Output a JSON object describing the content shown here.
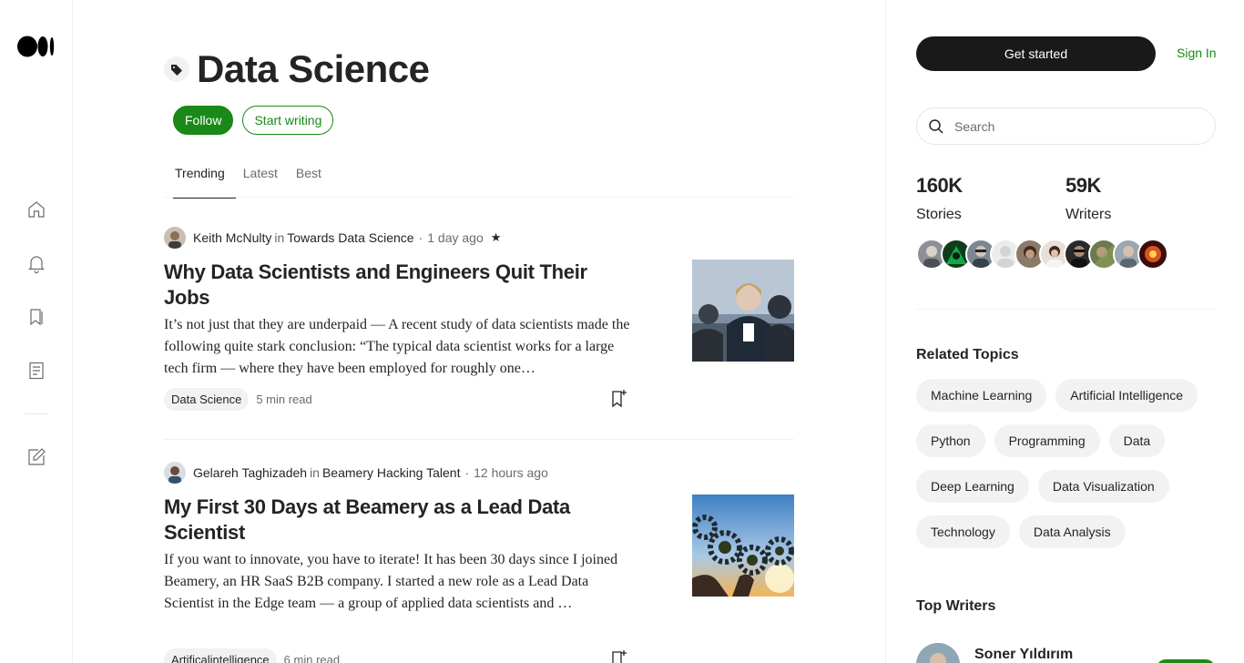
{
  "nav": {
    "logo": "medium-logo"
  },
  "topic": {
    "title": "Data Science",
    "follow_label": "Follow",
    "start_writing_label": "Start writing"
  },
  "tabs": [
    {
      "label": "Trending"
    },
    {
      "label": "Latest"
    },
    {
      "label": "Best"
    }
  ],
  "articles": [
    {
      "author": "Keith McNulty",
      "in": "in",
      "publication": "Towards Data Science",
      "time": "1 day ago",
      "member_star": "★",
      "title": "Why Data Scientists and Engineers Quit Their Jobs",
      "excerpt": "It’s not just that they are underpaid — A recent study of data scientists made the following quite stark conclusion: “The typical data scientist works for a large tech firm — where they have been employed for roughly one…",
      "tag": "Data Science",
      "read_time": "5 min read"
    },
    {
      "author": "Gelareh Taghizadeh",
      "in": "in",
      "publication": "Beamery Hacking Talent",
      "time": "12 hours ago",
      "title": "My First 30 Days at Beamery as a Lead Data Scientist",
      "excerpt": "If you want to innovate, you have to iterate! It has been 30 days since I joined Beamery, an HR SaaS B2B company. I started a new role as a Lead Data Scientist in the Edge team — a group of applied data scientists and …",
      "tag": "Artificalintelligence",
      "read_time": "6 min read"
    }
  ],
  "sidebar": {
    "get_started_label": "Get started",
    "sign_in_label": "Sign In",
    "search_placeholder": "Search",
    "stats": [
      {
        "value": "160K",
        "label": "Stories"
      },
      {
        "value": "59K",
        "label": "Writers"
      }
    ],
    "related_title": "Related Topics",
    "related_topics": [
      "Machine Learning",
      "Artificial Intelligence",
      "Python",
      "Programming",
      "Data",
      "Deep Learning",
      "Data Visualization",
      "Technology",
      "Data Analysis"
    ],
    "top_writers_title": "Top Writers",
    "top_writer_name": "Soner Yıldırım"
  },
  "colors": {
    "accent_green": "#1a8917",
    "dark_button": "#191919"
  }
}
